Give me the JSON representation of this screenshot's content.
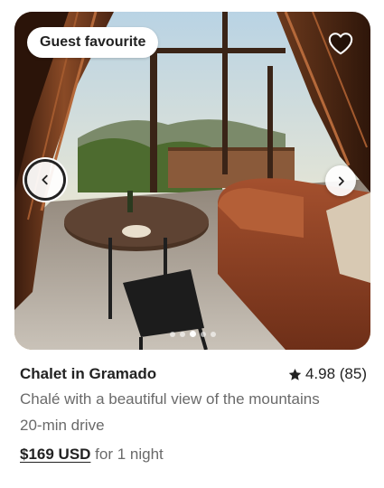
{
  "listing": {
    "badge": "Guest favourite",
    "title": "Chalet in Gramado",
    "rating": "4.98 (85)",
    "description": "Chalé with a beautiful view of the mountains",
    "distance": "20-min drive",
    "price": "$169 USD",
    "price_suffix": "for 1 night"
  },
  "gallery": {
    "image_count": 5,
    "active_index": 2
  },
  "icons": {
    "favorite": "heart-outline-icon",
    "previous": "chevron-left-icon",
    "next": "chevron-right-icon",
    "rating": "star-icon"
  },
  "colors": {
    "text_primary": "#222222",
    "text_secondary": "#6a6a6a",
    "badge_bg": "#ffffff"
  }
}
